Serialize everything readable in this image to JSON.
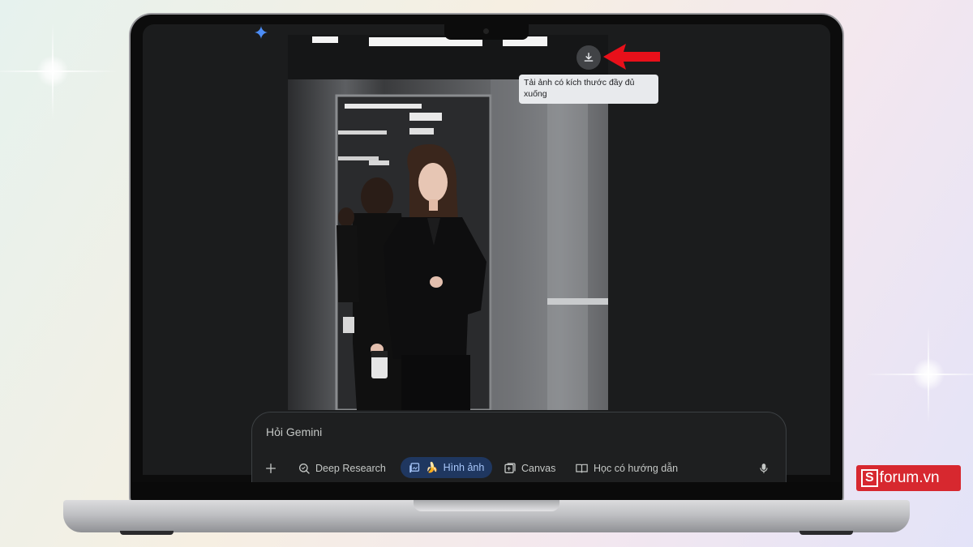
{
  "window": {
    "app": "Gemini"
  },
  "image_viewer": {
    "download_tooltip": "Tải ảnh có kích thước đầy đủ xuống",
    "download_icon": "download-icon"
  },
  "prompt": {
    "placeholder": "Hỏi Gemini",
    "tools": [
      {
        "label": "Deep Research",
        "icon": "deep-research-icon"
      },
      {
        "label": "Hình ảnh",
        "icon": "image-icon",
        "active": true
      },
      {
        "label": "Canvas",
        "icon": "canvas-icon"
      },
      {
        "label": "Học có hướng dẫn",
        "icon": "guided-learning-icon"
      }
    ],
    "add_icon": "plus-icon",
    "mic_icon": "mic-icon"
  },
  "watermark": {
    "brand_letter": "S",
    "text": "forum.vn"
  },
  "colors": {
    "accent": "#a8c7fa",
    "active_chip_bg": "#1f3760",
    "arrow": "#e8101a",
    "watermark_bg": "#d7282f"
  }
}
